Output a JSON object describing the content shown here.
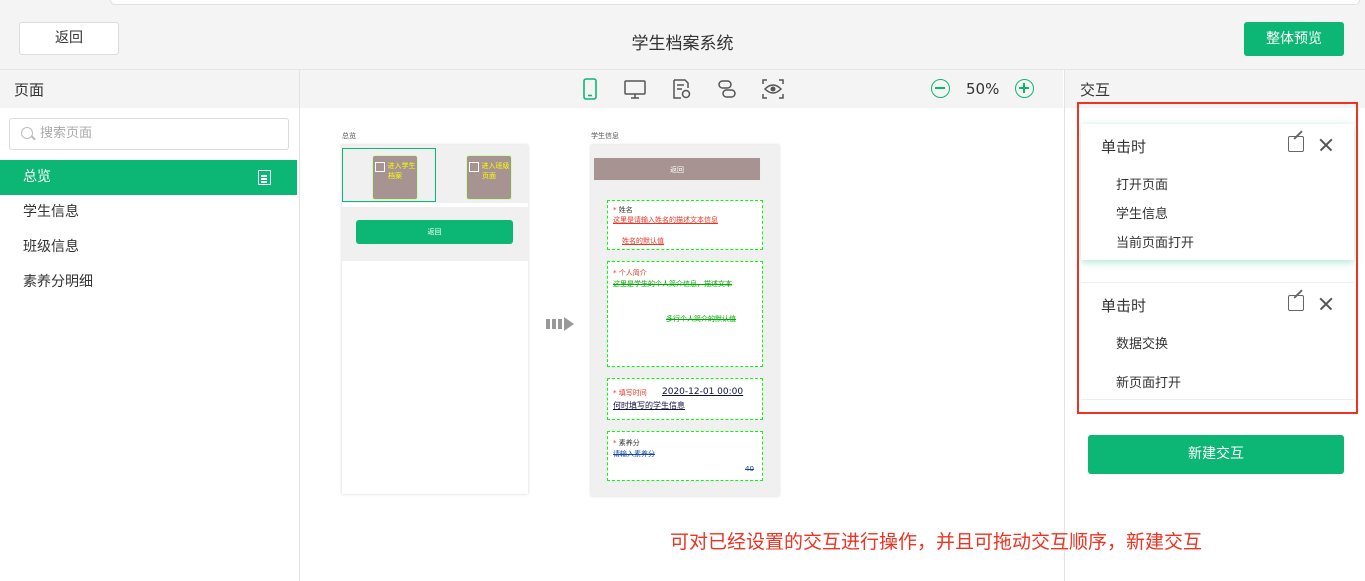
{
  "header": {
    "back_label": "返回",
    "title": "学生档案系统",
    "preview_label": "整体预览"
  },
  "left_panel": {
    "title": "页面",
    "search_placeholder": "搜索页面",
    "items": [
      {
        "label": "总览",
        "active": true
      },
      {
        "label": "学生信息",
        "active": false
      },
      {
        "label": "班级信息",
        "active": false
      },
      {
        "label": "素养分明细",
        "active": false
      }
    ]
  },
  "toolbar": {
    "icons": [
      "phone-icon",
      "desktop-icon",
      "page-settings-icon",
      "link-icon",
      "preview-eye-icon"
    ],
    "zoom": "50%"
  },
  "canvas": {
    "page1": {
      "label": "总览",
      "card1_text": "进入学生档案",
      "card2_text": "进入班级页面",
      "button": "返回"
    },
    "page2": {
      "label": "学生信息",
      "top_button": "返回",
      "name_label": "姓名",
      "name_hint": "这里是请输入姓名的描述文本信息",
      "name_default": "姓名的默认值",
      "intro_label": "个人简介",
      "intro_hint": "这里是学生的个人简介信息，描述文本",
      "intro_default": "多行个人简介的默认值",
      "time_label": "填写时间",
      "time_value": "2020-12-01 00:00",
      "time_note": "何时填写的学生信息",
      "score_label": "素养分",
      "score_hint": "请输入素养分",
      "score_value": "40"
    }
  },
  "right_panel": {
    "title": "交互",
    "cards": [
      {
        "trigger": "单击时",
        "items": [
          "打开页面",
          "学生信息",
          "当前页面打开"
        ]
      },
      {
        "trigger": "单击时",
        "items": [
          "数据交换",
          "新页面打开"
        ]
      }
    ],
    "new_label": "新建交互"
  },
  "annotation": "可对已经设置的交互进行操作，并且可拖动交互顺序，新建交互",
  "colors": {
    "accent": "#0cb775",
    "annotation": "#ee3322",
    "dashed": "#00ff00"
  }
}
